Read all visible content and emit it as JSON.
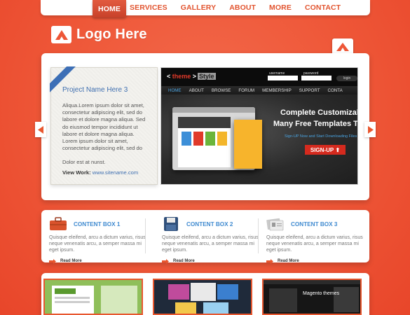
{
  "nav": {
    "items": [
      "HOME",
      "SERVICES",
      "GALLERY",
      "ABOUT",
      "MORE",
      "CONTACT"
    ],
    "active": "HOME"
  },
  "logo": {
    "text": "Logo Here",
    "icon": "triangle-logo-icon"
  },
  "colors": {
    "accent": "#ee5637",
    "link": "#3f6fb0",
    "heading_blue": "#3f8ad0"
  },
  "slider": {
    "project_title": "Project Name Here 3",
    "paragraph1": "Aliqua.Lorem ipsum dolor sit amet, consectetur adipiscing elit, sed do labore et dolore magna aliqua. Sed do eiusmod tempor incididunt ut labore et dolore magna aliqua. Lorem ipsum dolor sit amet, consectetur adipiscing elit, sed do",
    "paragraph2": "Dolor est at nunst.",
    "view_work_label": "View Work:",
    "view_work_link": "www.sitename.com",
    "preview": {
      "logo_prefix": "< ",
      "logo_brand": "theme",
      "logo_suffix": " >",
      "logo_style": "Style",
      "username_label": "username",
      "password_label": "password",
      "login_label": "login",
      "nav": [
        "HOME",
        "ABOUT",
        "BROWSE",
        "FORUM",
        "MEMBERSHIP",
        "SUPPORT",
        "CONTA"
      ],
      "promo_line1": "Complete Customizable We",
      "promo_line2": "Many Free Templates To Cho",
      "promo_line3": "Sign-UP Now and Start Downloading Files",
      "signup_label": "SIGN-UP"
    }
  },
  "content_boxes": [
    {
      "title": "CONTENT BOX 1",
      "icon": "briefcase-icon",
      "text": "Quisque eleifend, arcu a dictum varius, risus neque venenatis arcu, a semper massa mi eget ipsum.",
      "more": "Read More"
    },
    {
      "title": "CONTENT BOX 2",
      "icon": "floppy-disk-icon",
      "text": "Quisque eleifend, arcu a dictum varius, risus neque venenatis arcu, a semper massa mi eget ipsum.",
      "more": "Read More"
    },
    {
      "title": "CONTENT BOX 3",
      "icon": "id-cards-icon",
      "text": "Quisque eleifend, arcu a dictum varius, risus neque venenatis arcu, a semper massa mi eget ipsum.",
      "more": "Read More"
    }
  ],
  "gallery": {
    "thumb3_caption": "Magento themes"
  }
}
